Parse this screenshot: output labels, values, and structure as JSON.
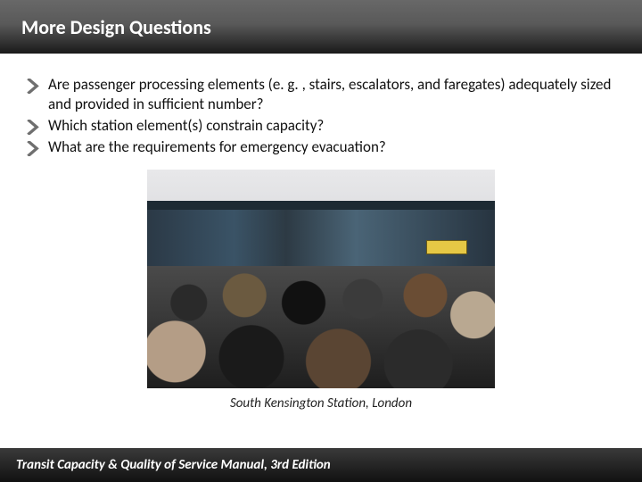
{
  "title": "More Design Questions",
  "bullets": [
    "Are passenger processing elements (e. g. , stairs, escalators, and faregates) adequately sized and provided in sufficient number?",
    "Which station element(s) constrain capacity?",
    "What are the requirements for emergency evacuation?"
  ],
  "caption": "South Kensington Station, London",
  "footer": "Transit Capacity & Quality of Service Manual, 3rd Edition",
  "chevron_color": "#6f6f6f"
}
